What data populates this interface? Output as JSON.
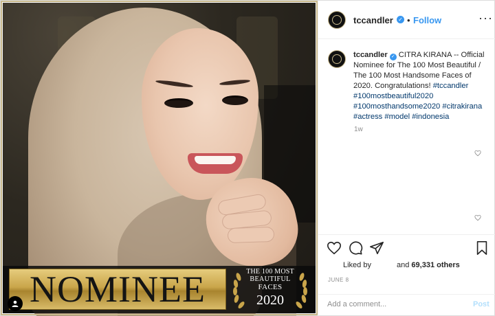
{
  "post_image": {
    "banner_text": "NOMINEE",
    "award_line1": "THE 100 MOST",
    "award_line2": "BEAUTIFUL",
    "award_line3": "FACES",
    "award_line4": "2020",
    "tag_icon": "user-tag-icon"
  },
  "header": {
    "username": "tccandler",
    "verified_icon": "verified-badge-icon",
    "separator": "•",
    "follow_label": "Follow",
    "more_label": "···"
  },
  "caption": {
    "username": "tccandler",
    "text_before": "CITRA KIRANA -- Official Nominee for The 100 Most Beautiful / The 100 Most Handsome Faces of 2020. Congratulations!",
    "hashtags": [
      "#tccandler",
      "#100mostbeautiful2020",
      "#100mosthandsome2020",
      "#citrakirana",
      "#actress",
      "#model",
      "#indonesia"
    ],
    "time": "1w"
  },
  "actions": {
    "icons": [
      "heart-icon",
      "comment-icon",
      "share-icon",
      "bookmark-icon"
    ],
    "liked_by": "Liked by",
    "liked_and": "and",
    "liked_count": "69,331 others",
    "date": "JUNE 8",
    "comment_placeholder": "Add a comment...",
    "post_label": "Post"
  },
  "colors": {
    "accent": "#3897f0",
    "gold": "#c9a54a",
    "text": "#262626",
    "muted": "#8e8e8e",
    "hashtag": "#00376b"
  }
}
